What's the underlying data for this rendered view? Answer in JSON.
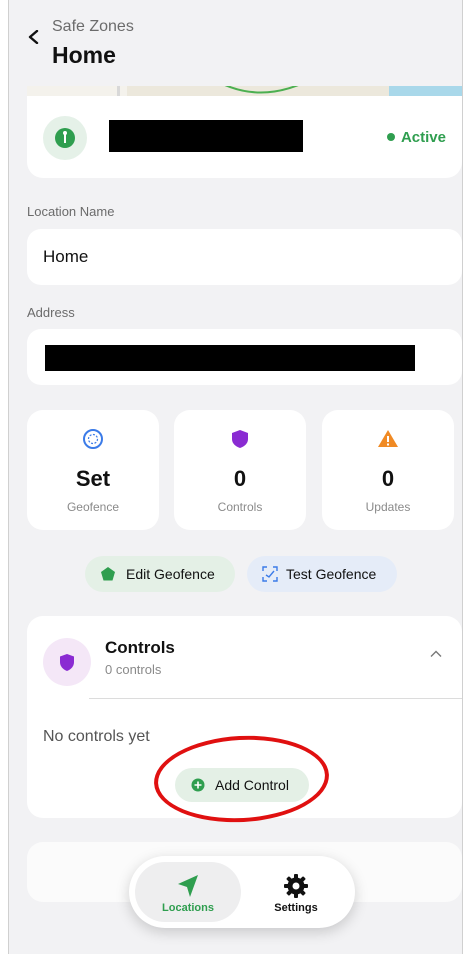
{
  "header": {
    "breadcrumb": "Safe Zones",
    "title": "Home"
  },
  "status": {
    "label": "Active",
    "color": "#2f9e4f"
  },
  "fields": {
    "location_label": "Location Name",
    "location_value": "Home",
    "address_label": "Address"
  },
  "stats": [
    {
      "value": "Set",
      "caption": "Geofence",
      "icon": "target-icon"
    },
    {
      "value": "0",
      "caption": "Controls",
      "icon": "shield-icon"
    },
    {
      "value": "0",
      "caption": "Updates",
      "icon": "warning-icon"
    }
  ],
  "actions": {
    "edit": "Edit Geofence",
    "test": "Test Geofence"
  },
  "controls": {
    "title": "Controls",
    "subtitle": "0 controls",
    "empty_text": "No controls yet",
    "add_label": "Add Control"
  },
  "tabs": [
    {
      "label": "Locations",
      "icon": "navigation-arrow-icon",
      "active": true
    },
    {
      "label": "Settings",
      "icon": "gear-icon",
      "active": false
    }
  ],
  "colors": {
    "accent_green": "#2f9e4f",
    "shield_purple": "#8a2bd2",
    "warning_orange": "#f08a24",
    "geofence_blue": "#3b7be8",
    "highlight_red": "#e01010"
  }
}
